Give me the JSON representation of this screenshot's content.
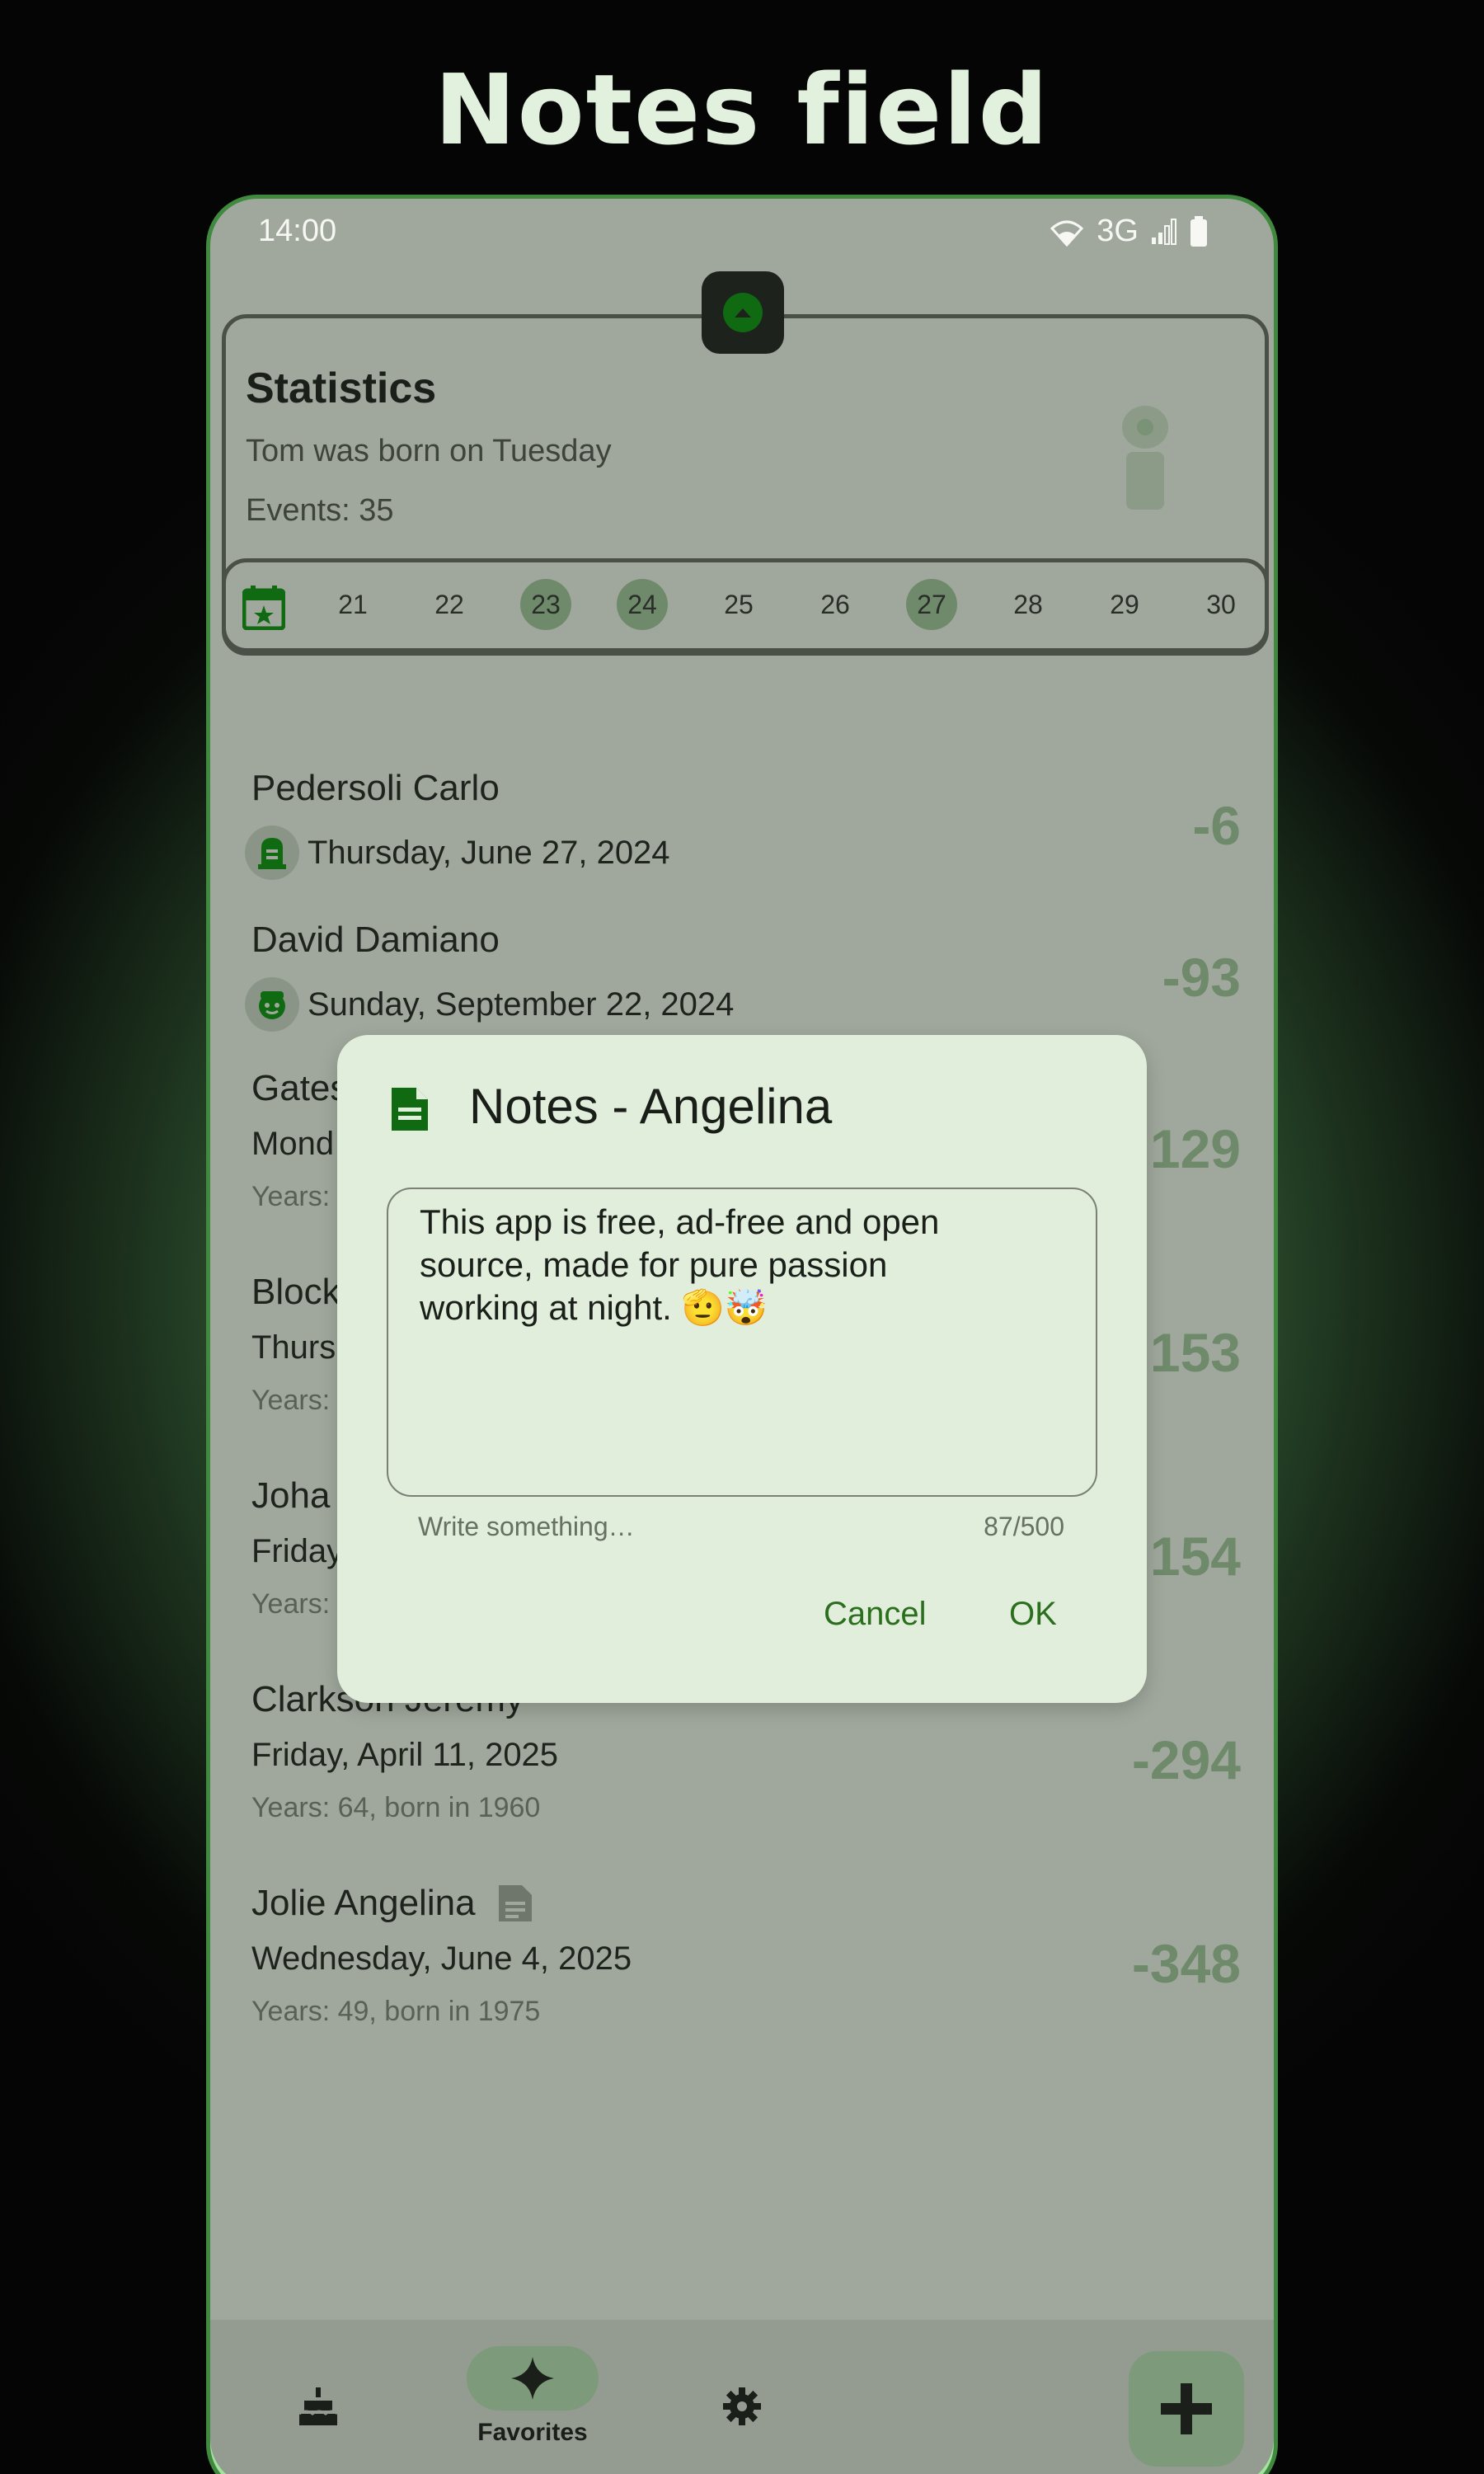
{
  "promo": {
    "title": "Notes field"
  },
  "status_bar": {
    "time": "14:00",
    "network": "3G"
  },
  "stats": {
    "title": "Statistics",
    "subtitle": "Tom was born on Tuesday",
    "events": "Events: 35"
  },
  "date_strip": {
    "days": [
      "21",
      "22",
      "23",
      "24",
      "25",
      "26",
      "27",
      "28",
      "29",
      "30"
    ],
    "event_days": [
      "23",
      "24",
      "27"
    ]
  },
  "list": [
    {
      "name": "Pedersoli Carlo",
      "date": "Thursday, June 27, 2024",
      "years": "",
      "count": "-6",
      "avatar": "tombstone-icon"
    },
    {
      "name": "David Damiano",
      "date": "Sunday, September 22, 2024",
      "years": "",
      "count": "-93",
      "avatar": "face-icon"
    },
    {
      "name": "Gates",
      "date": "Mond",
      "years": "Years:",
      "count": "129"
    },
    {
      "name": "Block",
      "date": "Thurs",
      "years": "Years:",
      "count": "153"
    },
    {
      "name": "Joha",
      "date": "Friday",
      "years": "Years:",
      "count": "154"
    },
    {
      "name": "Clarkson Jeremy",
      "date": "Friday, April 11, 2025",
      "years": "Years: 64, born in 1960",
      "count": "-294"
    },
    {
      "name": "Jolie Angelina",
      "date": "Wednesday, June 4, 2025",
      "years": "Years: 49, born in 1975",
      "count": "-348",
      "note_icon": "note-icon"
    }
  ],
  "dialog": {
    "title": "Notes - Angelina",
    "notes_value": "This app is free, ad-free and open\nsource, made for pure passion\nworking at night. 🫡🤯",
    "placeholder": "Write something…",
    "counter": "87/500",
    "cancel_label": "Cancel",
    "ok_label": "OK"
  },
  "bottom_nav": {
    "items": [
      {
        "icon": "cake-icon",
        "label": ""
      },
      {
        "icon": "sparkle-icon",
        "label": "Favorites",
        "selected": true
      },
      {
        "icon": "gear-icon",
        "label": ""
      }
    ],
    "fab_icon": "plus-icon"
  },
  "colors": {
    "accent": "#0f6a12",
    "muted_count": "#6e8a6a",
    "dialog_bg": "#e1eedb"
  }
}
